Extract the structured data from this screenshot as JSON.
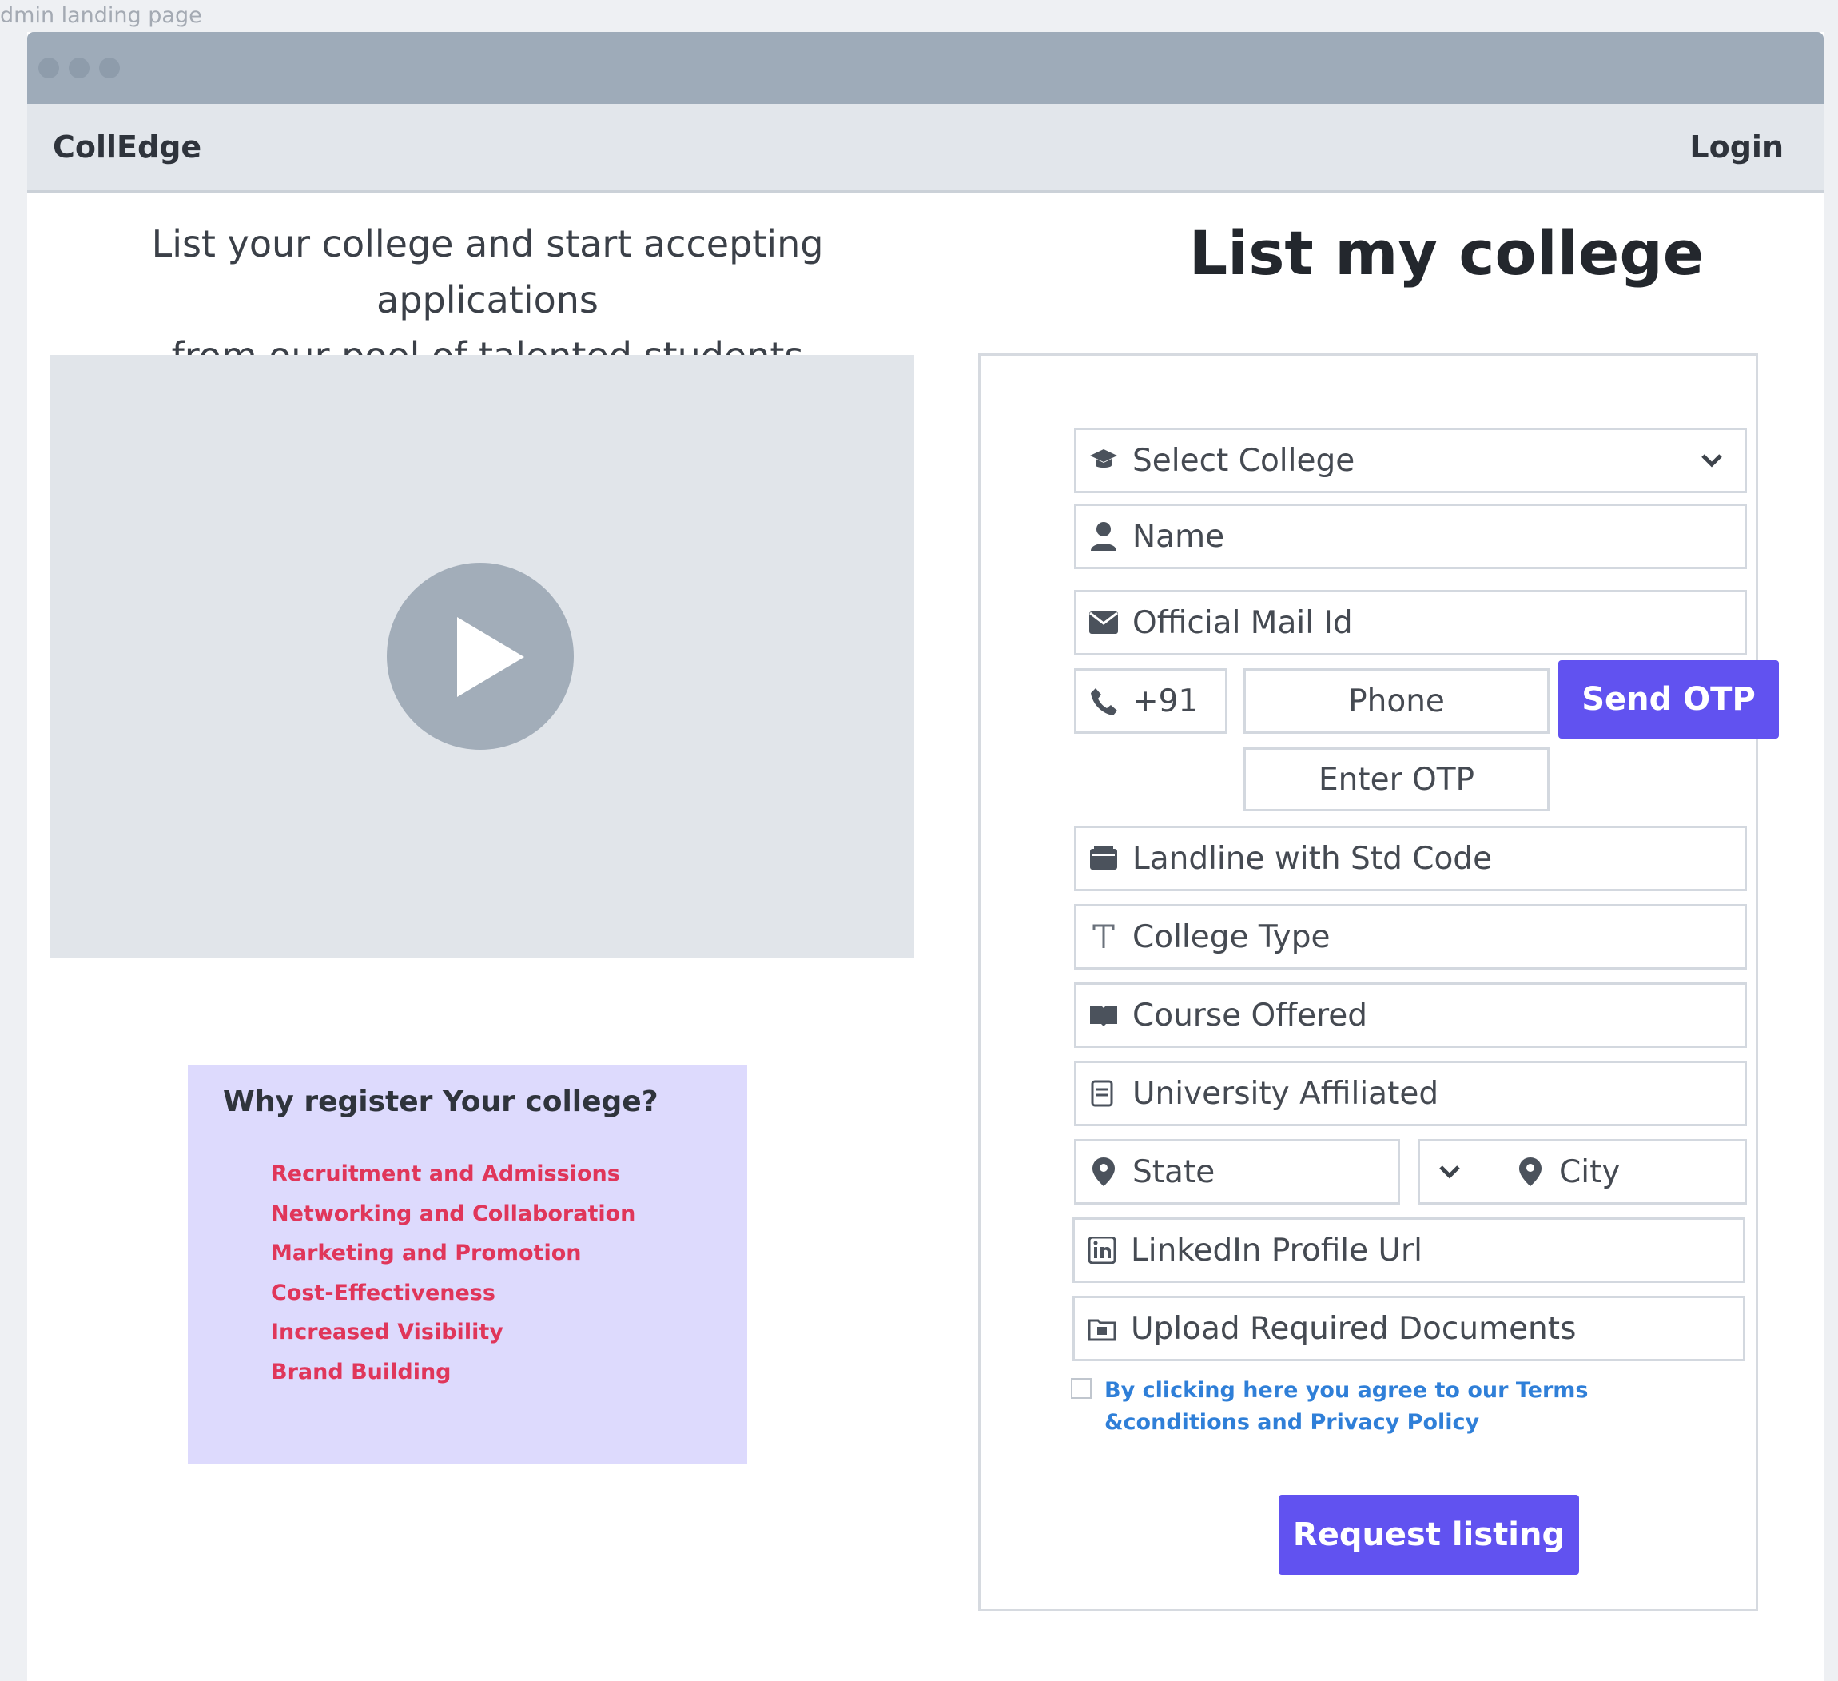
{
  "frame_caption": "dmin landing page",
  "navbar": {
    "brand": "CollEdge",
    "login": "Login"
  },
  "hero": {
    "tagline_line1": "List your college and start accepting applications",
    "tagline_line2": "from our pool of talented students"
  },
  "video": {
    "icon": "play-icon"
  },
  "why_register": {
    "title": "Why register Your college?",
    "items": [
      "Recruitment and Admissions",
      "Networking and Collaboration",
      "Marketing and Promotion",
      "Cost-Effectiveness",
      "Increased Visibility",
      "Brand Building"
    ]
  },
  "form": {
    "title": "List my college",
    "select_college": "Select College",
    "name": "Name",
    "official_mail": "Official Mail Id",
    "country_code": "+91",
    "phone": "Phone",
    "send_otp": "Send OTP",
    "enter_otp": "Enter OTP",
    "landline": "Landline with Std Code",
    "college_type": "College Type",
    "course_offered": "Course Offered",
    "university_affiliated": "University Affiliated",
    "state": "State",
    "city": "City",
    "linkedin": "LinkedIn Profile Url",
    "upload_docs": "Upload Required Documents",
    "terms": "By clicking here you agree to our Terms &conditions and Privacy Policy",
    "request_listing": "Request listing"
  },
  "colors": {
    "accent": "#6152f0",
    "list_text": "#e0365a",
    "terms_link": "#2f7fd8",
    "why_panel": "#dddafd",
    "titlebar": "#9eabb9"
  }
}
